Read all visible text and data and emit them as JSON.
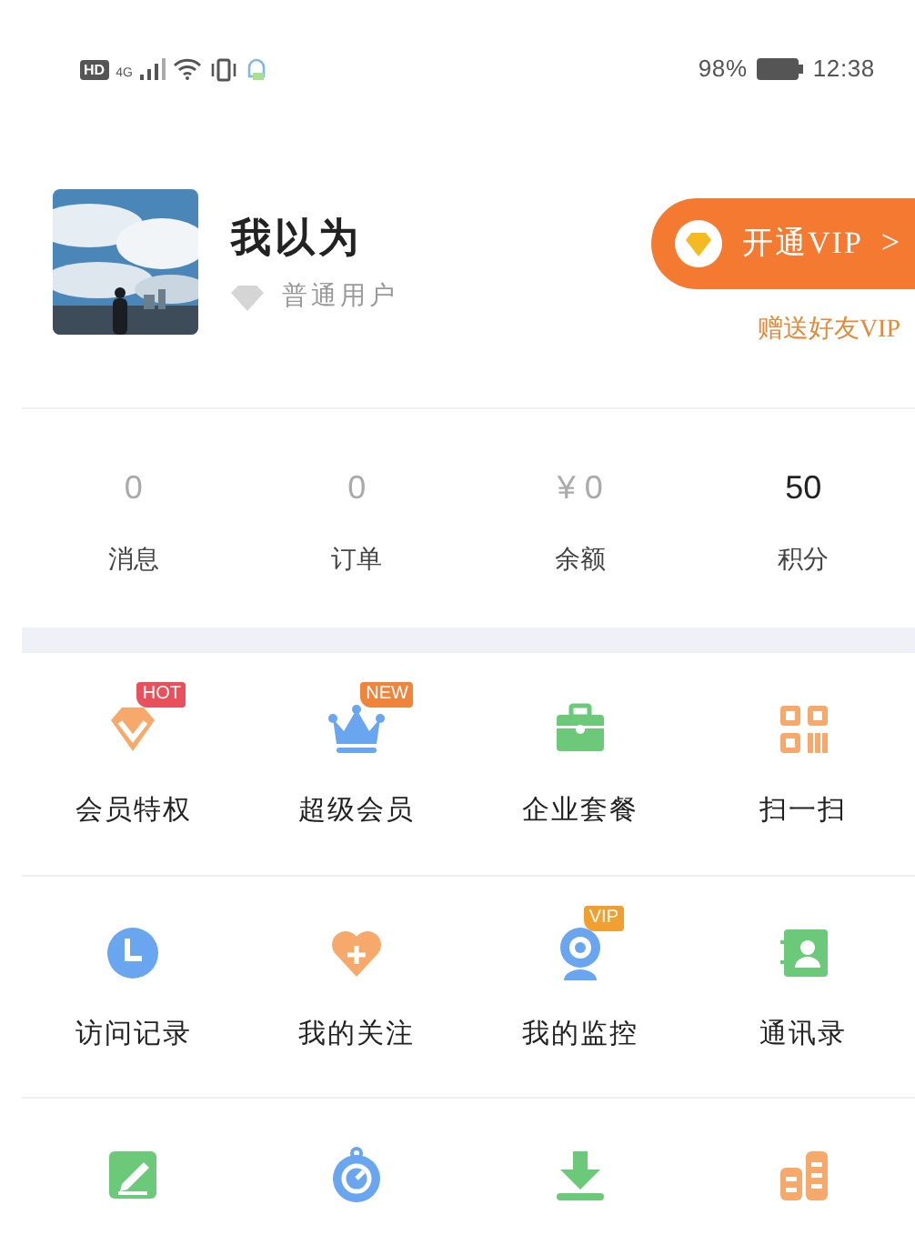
{
  "status_bar": {
    "hd": "HD",
    "network": "4G",
    "battery": "98%",
    "time": "12:38"
  },
  "profile": {
    "name": "我以为",
    "level": "普通用户",
    "vip_button": "开通VIP",
    "vip_arrow": ">",
    "gift_link": "赠送好友VIP"
  },
  "stats": [
    {
      "value": "0",
      "label": "消息",
      "emphasis": false
    },
    {
      "value": "0",
      "label": "订单",
      "emphasis": false
    },
    {
      "prefix": "¥",
      "value": "0",
      "label": "余额",
      "emphasis": false
    },
    {
      "value": "50",
      "label": "积分",
      "emphasis": true
    }
  ],
  "grid": [
    [
      {
        "kind": "diamond",
        "label": "会员特权",
        "badge": {
          "text": "HOT",
          "color": "#e8505b"
        }
      },
      {
        "kind": "crown",
        "label": "超级会员",
        "badge": {
          "text": "NEW",
          "color": "#f0843a"
        }
      },
      {
        "kind": "briefcase",
        "label": "企业套餐"
      },
      {
        "kind": "scan",
        "label": "扫一扫"
      }
    ],
    [
      {
        "kind": "clock",
        "label": "访问记录"
      },
      {
        "kind": "heart",
        "label": "我的关注"
      },
      {
        "kind": "camera",
        "label": "我的监控",
        "badge": {
          "text": "VIP",
          "color": "#f0a030"
        }
      },
      {
        "kind": "contacts",
        "label": "通讯录"
      }
    ],
    [
      {
        "kind": "edit"
      },
      {
        "kind": "timer"
      },
      {
        "kind": "download"
      },
      {
        "kind": "buildings"
      }
    ]
  ]
}
